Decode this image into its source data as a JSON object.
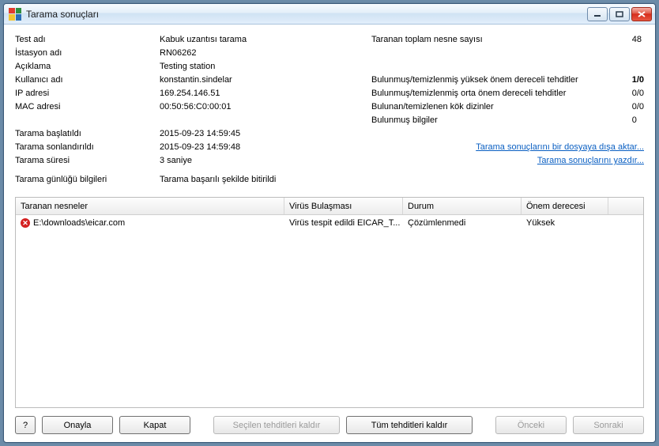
{
  "title": "Tarama sonuçları",
  "info_left": [
    {
      "label": "Test adı",
      "value": "Kabuk uzantısı tarama"
    },
    {
      "label": "İstasyon adı",
      "value": "RN06262"
    },
    {
      "label": "Açıklama",
      "value": "Testing station"
    },
    {
      "label": "Kullanıcı adı",
      "value": "konstantin.sindelar"
    },
    {
      "label": "IP adresi",
      "value": "169.254.146.51"
    },
    {
      "label": "MAC adresi",
      "value": "00:50:56:C0:00:01"
    }
  ],
  "info_left2": [
    {
      "label": "Tarama başlatıldı",
      "value": "2015-09-23 14:59:45"
    },
    {
      "label": "Tarama sonlandırıldı",
      "value": "2015-09-23 14:59:48"
    },
    {
      "label": "Tarama süresi",
      "value": "3 saniye"
    }
  ],
  "info_left3": [
    {
      "label": "Tarama günlüğü bilgileri",
      "value": "Tarama başarılı şekilde bitirildi"
    }
  ],
  "info_right": [
    {
      "label": "Taranan toplam nesne sayısı",
      "value": "48",
      "red": false
    }
  ],
  "info_right2": [
    {
      "label": "Bulunmuş/temizlenmiş yüksek önem dereceli tehditler",
      "value": "1/0",
      "red": true
    },
    {
      "label": "Bulunmuş/temizlenmiş orta önem dereceli tehditler",
      "value": "0/0",
      "red": false
    },
    {
      "label": "Bulunan/temizlenen kök dizinler",
      "value": "0/0",
      "red": false
    },
    {
      "label": "Bulunmuş bilgiler",
      "value": "0",
      "red": false
    }
  ],
  "links": {
    "export": "Tarama sonuçlarını bir dosyaya dışa aktar...",
    "print": "Tarama sonuçlarını yazdır..."
  },
  "table": {
    "headers": [
      "Taranan nesneler",
      "Virüs Bulaşması",
      "Durum",
      "Önem derecesi",
      ""
    ],
    "rows": [
      {
        "object": "E:\\downloads\\eicar.com",
        "infection": "Virüs tespit edildi EICAR_T...",
        "status": "Çözümlenmedi",
        "severity": "Yüksek"
      }
    ]
  },
  "buttons": {
    "help": "?",
    "approve": "Onayla",
    "close": "Kapat",
    "remove_selected": "Seçilen tehditleri kaldır",
    "remove_all": "Tüm tehditleri kaldır",
    "prev": "Önceki",
    "next": "Sonraki"
  }
}
